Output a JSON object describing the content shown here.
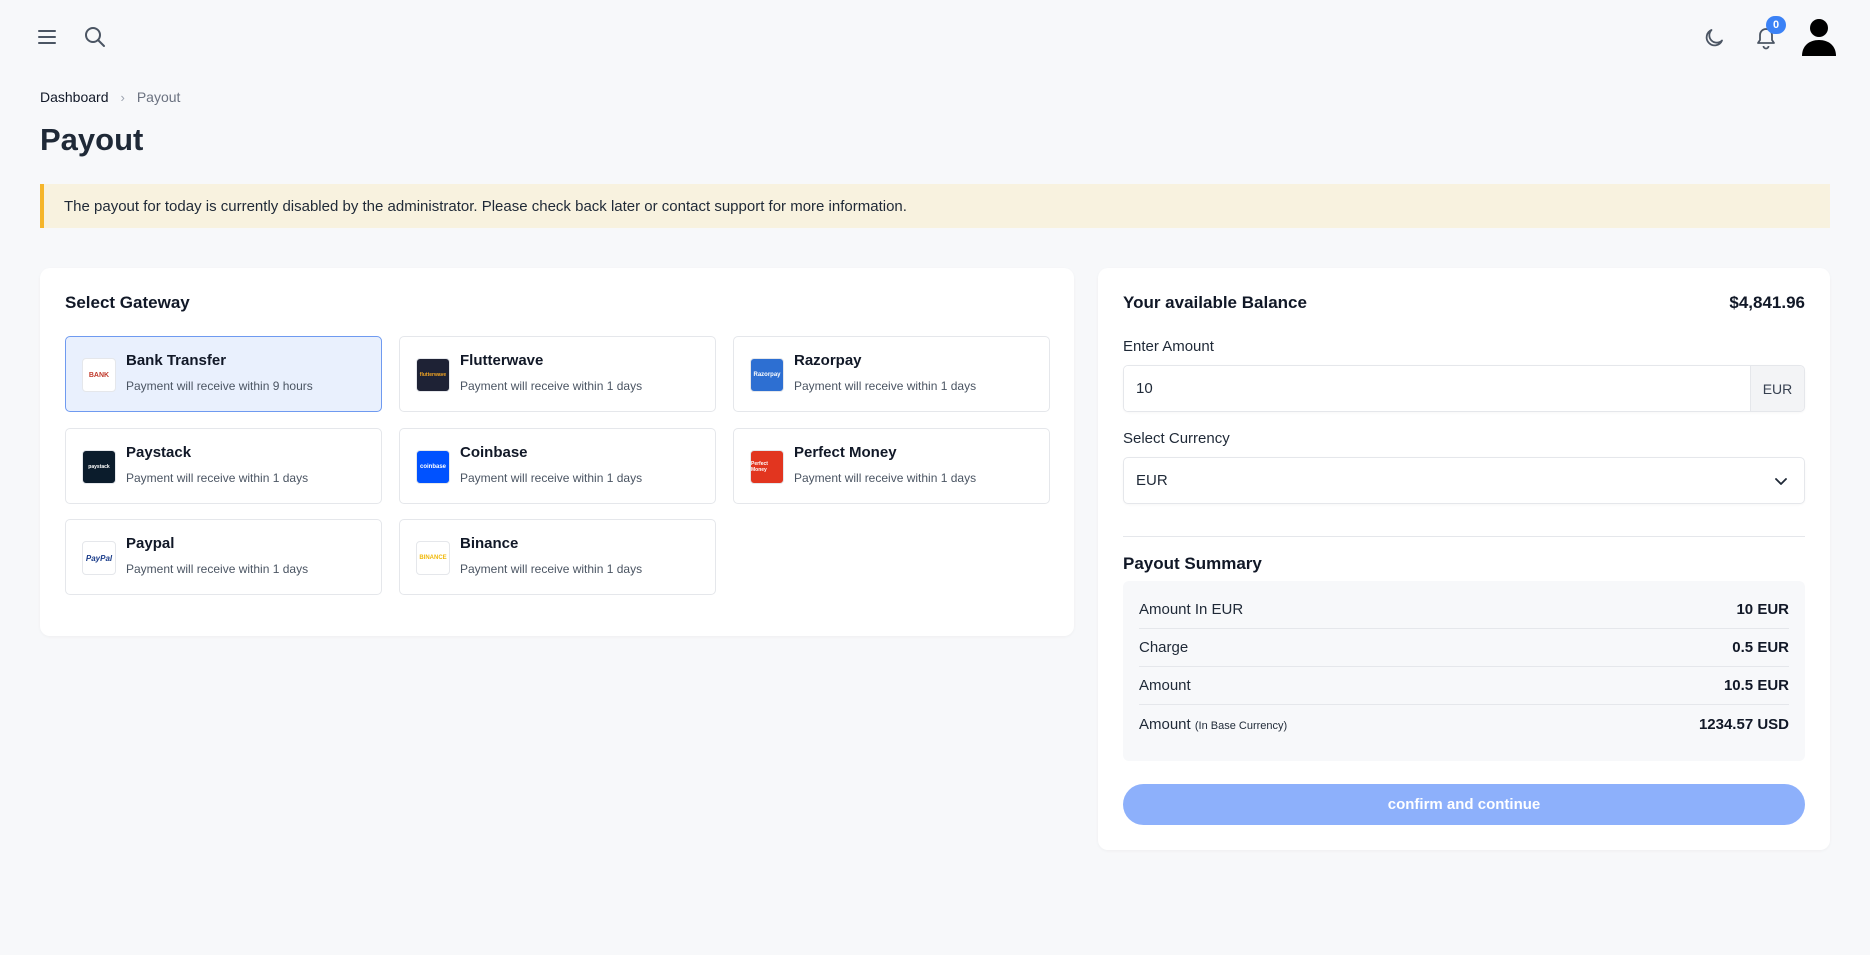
{
  "header": {
    "notification_count": "0",
    "icons": [
      "menu-icon",
      "search-icon",
      "moon-icon",
      "bell-icon",
      "avatar"
    ]
  },
  "breadcrumb": {
    "home": "Dashboard",
    "separator": "›",
    "current": "Payout"
  },
  "page_title": "Payout",
  "alert": {
    "message": "The payout for today is currently disabled by the administrator. Please check back later or contact support for more information.",
    "accent_color": "#f5b52a"
  },
  "gateway": {
    "heading": "Select Gateway",
    "items": [
      {
        "name": "Bank Transfer",
        "desc": "Payment will receive within 9 hours",
        "logo": "BANK",
        "selected": true
      },
      {
        "name": "Flutterwave",
        "desc": "Payment will receive within 1 days",
        "logo": "flutterwave"
      },
      {
        "name": "Razorpay",
        "desc": "Payment will receive within 1 days",
        "logo": "Razorpay"
      },
      {
        "name": "Paystack",
        "desc": "Payment will receive within 1 days",
        "logo": "paystack"
      },
      {
        "name": "Coinbase",
        "desc": "Payment will receive within 1 days",
        "logo": "coinbase"
      },
      {
        "name": "Perfect Money",
        "desc": "Payment will receive within 1 days",
        "logo": "Perfect Money"
      },
      {
        "name": "Paypal",
        "desc": "Payment will receive within 1 days",
        "logo": "PayPal"
      },
      {
        "name": "Binance",
        "desc": "Payment will receive within 1 days",
        "logo": "BINANCE"
      }
    ]
  },
  "balance": {
    "label": "Your available Balance",
    "value": "$4,841.96"
  },
  "form": {
    "amount_label": "Enter Amount",
    "amount_value": "10",
    "amount_suffix": "EUR",
    "currency_label": "Select Currency",
    "currency_value": "EUR"
  },
  "summary": {
    "heading": "Payout Summary",
    "rows": [
      {
        "label": "Amount In EUR",
        "value": "10 EUR"
      },
      {
        "label": "Charge",
        "value": "0.5 EUR"
      },
      {
        "label": "Amount",
        "value": "10.5 EUR"
      },
      {
        "label": "Amount",
        "sublabel": "(In Base Currency)",
        "value": "1234.57 USD"
      }
    ]
  },
  "confirm_button": "confirm and continue",
  "colors": {
    "primary": "#3b82f6",
    "button_disabled": "#8db0fb",
    "selected_bg": "#e9f0fd"
  }
}
